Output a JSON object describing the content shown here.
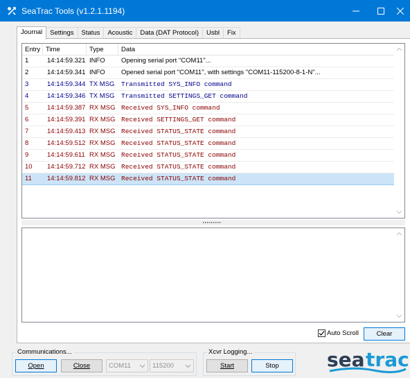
{
  "window": {
    "title": "SeaTrac Tools (v1.2.1.1194)"
  },
  "tabs": [
    {
      "label": "Journal"
    },
    {
      "label": "Settings"
    },
    {
      "label": "Status"
    },
    {
      "label": "Acoustic"
    },
    {
      "label": "Data (DAT Protocol)"
    },
    {
      "label": "Usbl"
    },
    {
      "label": "Fix"
    }
  ],
  "journal": {
    "columns": {
      "entry": "Entry",
      "time": "Time",
      "type": "Type",
      "data": "Data"
    },
    "rows": [
      {
        "entry": "1",
        "time": "14:14:59.321",
        "type": "INFO",
        "data": "Opening serial port \"COM11\"..."
      },
      {
        "entry": "2",
        "time": "14:14:59.341",
        "type": "INFO",
        "data": "Opened serial port \"COM11\", with settings \"COM11-115200-8-1-N\"..."
      },
      {
        "entry": "3",
        "time": "14:14:59.344",
        "type": "TX MSG",
        "data": "Transmitted SYS_INFO command"
      },
      {
        "entry": "4",
        "time": "14:14:59.346",
        "type": "TX MSG",
        "data": "Transmitted SETTINGS_GET command"
      },
      {
        "entry": "5",
        "time": "14:14:59.387",
        "type": "RX MSG",
        "data": "Received SYS_INFO command"
      },
      {
        "entry": "6",
        "time": "14:14:59.391",
        "type": "RX MSG",
        "data": "Received SETTINGS_GET command"
      },
      {
        "entry": "7",
        "time": "14:14:59.413",
        "type": "RX MSG",
        "data": "Received STATUS_STATE command"
      },
      {
        "entry": "8",
        "time": "14:14:59.512",
        "type": "RX MSG",
        "data": "Received STATUS_STATE command"
      },
      {
        "entry": "9",
        "time": "14:14:59.611",
        "type": "RX MSG",
        "data": "Received STATUS_STATE command"
      },
      {
        "entry": "10",
        "time": "14:14:59.712",
        "type": "RX MSG",
        "data": "Received STATUS_STATE command"
      },
      {
        "entry": "11",
        "time": "14:14:59.812",
        "type": "RX MSG",
        "data": "Received STATUS_STATE command"
      }
    ],
    "selected_row": "11",
    "auto_scroll_label": "Auto Scroll",
    "auto_scroll_checked": true,
    "clear_label": "Clear"
  },
  "colors": {
    "info": "#000000",
    "tx": "#00008b",
    "rx": "#8b0000",
    "titlebar": "#0078d7",
    "logo_dark": "#2e3f56",
    "logo_accent": "#1a9ad7"
  },
  "communications": {
    "title": "Communications...",
    "open_label": "Open",
    "close_label": "Close",
    "port_value": "COM11",
    "baud_value": "115200"
  },
  "xcvr_logging": {
    "title": "Xcvr Logging...",
    "start_label": "Start",
    "stop_label": "Stop"
  },
  "logo": {
    "part1": "sea",
    "part2": "trac"
  }
}
